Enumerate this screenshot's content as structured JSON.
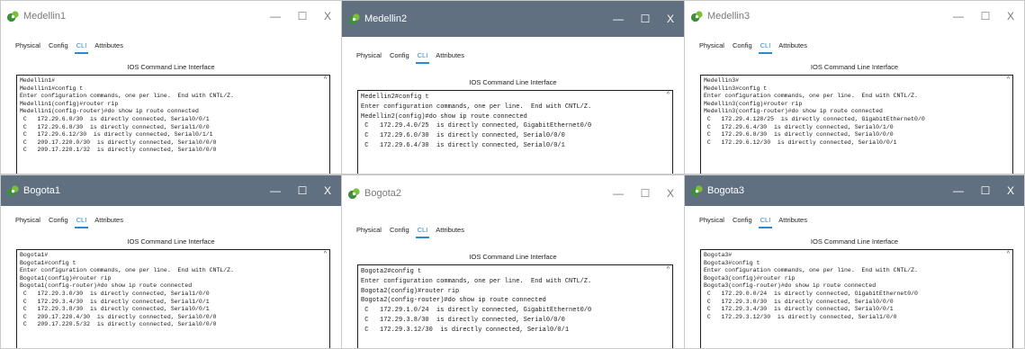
{
  "tab_labels": [
    "Physical",
    "Config",
    "CLI",
    "Attributes"
  ],
  "active_tab": "CLI",
  "cli_panel_title": "IOS Command Line Interface",
  "controls": {
    "minimize": "—",
    "maximize": "☐",
    "close": "X"
  },
  "colors": {
    "active_titlebar": "#607080",
    "inactive_titlebar": "#ffffff",
    "active_tab": "#2a8bd2",
    "console_border": "#1e1e1e"
  },
  "windows": [
    {
      "title": "Medellin1",
      "state": "inactive",
      "console_lines": [
        "Medellin1#",
        "Medellin1#config t",
        "Enter configuration commands, one per line.  End with CNTL/Z.",
        "Medellin1(config)#router rip",
        "Medellin1(config-router)#do show ip route connected",
        " C   172.29.6.0/30  is directly connected, Serial0/0/1",
        " C   172.29.6.8/30  is directly connected, Serial1/0/0",
        " C   172.29.6.12/30  is directly connected, Serial0/1/1",
        " C   209.17.220.0/30  is directly connected, Serial0/0/0",
        " C   209.17.220.1/32  is directly connected, Serial0/0/0"
      ]
    },
    {
      "title": "Medellin2",
      "state": "active",
      "console_lines": [
        "Medellin2#config t",
        "Enter configuration commands, one per line.  End with CNTL/Z.",
        "Medellin2(config)#do show ip route connected",
        " C   172.29.4.0/25  is directly connected, GigabitEthernet0/0",
        " C   172.29.6.0/30  is directly connected, Serial0/0/0",
        " C   172.29.6.4/30  is directly connected, Serial0/0/1"
      ]
    },
    {
      "title": "Medellin3",
      "state": "inactive",
      "console_lines": [
        "Medellin3#",
        "Medellin3#config t",
        "Enter configuration commands, one per line.  End with CNTL/Z.",
        "Medellin3(config)#router rip",
        "Medellin3(config-router)#do show ip route connected",
        " C   172.29.4.128/25  is directly connected, GigabitEthernet0/0",
        " C   172.29.6.4/30  is directly connected, Serial0/1/0",
        " C   172.29.6.8/30  is directly connected, Serial0/0/0",
        " C   172.29.6.12/30  is directly connected, Serial0/0/1"
      ]
    },
    {
      "title": "Bogota1",
      "state": "active",
      "console_lines": [
        "Bogota1#",
        "Bogota1#config t",
        "Enter configuration commands, one per line.  End with CNTL/Z.",
        "Bogota1(config)#router rip",
        "Bogota1(config-router)#do show ip route connected",
        " C   172.29.3.0/30  is directly connected, Serial1/0/0",
        " C   172.29.3.4/30  is directly connected, Serial1/0/1",
        " C   172.29.3.8/30  is directly connected, Serial0/0/1",
        " C   209.17.220.4/30  is directly connected, Serial0/0/0",
        " C   209.17.220.5/32  is directly connected, Serial0/0/0"
      ]
    },
    {
      "title": "Bogota2",
      "state": "inactive",
      "console_lines": [
        "Bogota2#config t",
        "Enter configuration commands, one per line.  End with CNTL/Z.",
        "Bogota2(config)#router rip",
        "Bogota2(config-router)#do show ip route connected",
        " C   172.29.1.0/24  is directly connected, GigabitEthernet0/0",
        " C   172.29.3.8/30  is directly connected, Serial0/0/0",
        " C   172.29.3.12/30  is directly connected, Serial0/0/1"
      ]
    },
    {
      "title": "Bogota3",
      "state": "active",
      "console_lines": [
        "Bogota3#",
        "Bogota3#config t",
        "Enter configuration commands, one per line.  End with CNTL/Z.",
        "Bogota3(config)#router rip",
        "Bogota3(config-router)#do show ip route connected",
        " C   172.29.0.0/24  is directly connected, GigabitEthernet0/0",
        " C   172.29.3.0/30  is directly connected, Serial0/0/0",
        " C   172.29.3.4/30  is directly connected, Serial0/0/1",
        " C   172.29.3.12/30  is directly connected, Serial1/0/0"
      ]
    }
  ]
}
